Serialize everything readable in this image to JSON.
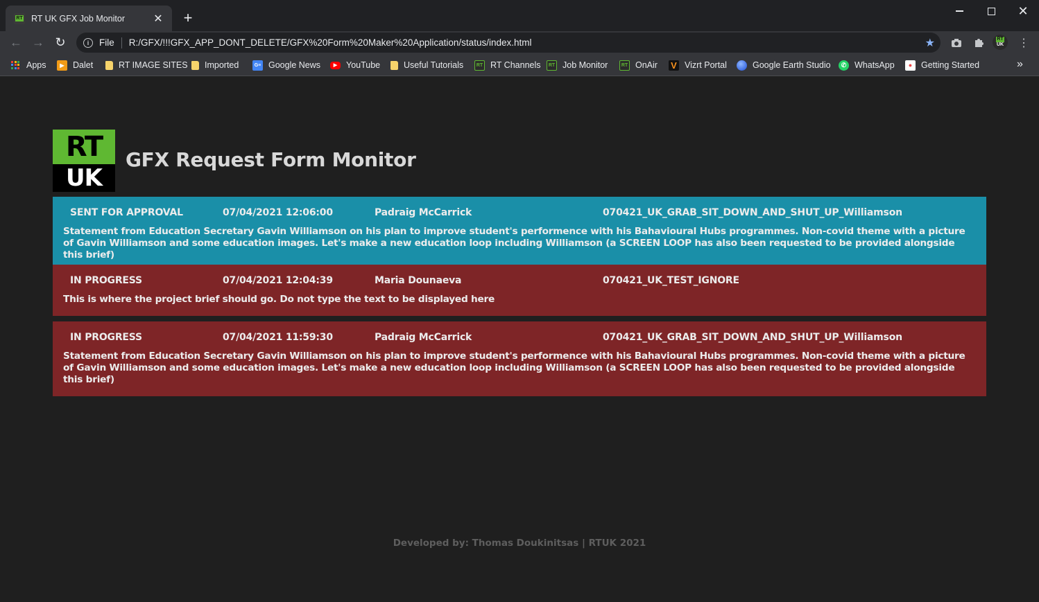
{
  "browser": {
    "tab_title": "RT UK GFX Job Monitor",
    "scheme_label": "File",
    "url": "R:/GFX/!!!GFX_APP_DONT_DELETE/GFX%20Form%20Maker%20Application/status/index.html",
    "profile_label_top": "RT",
    "profile_label_bottom": "UK"
  },
  "bookmarks": [
    {
      "label": "Apps",
      "icon": "apps-grid-icon"
    },
    {
      "label": "Dalet",
      "icon": "dalet-icon"
    },
    {
      "label": "RT IMAGE SITES",
      "icon": "folder-icon"
    },
    {
      "label": "Imported",
      "icon": "folder-icon"
    },
    {
      "label": "Google News",
      "icon": "google-news-icon"
    },
    {
      "label": "YouTube",
      "icon": "youtube-icon"
    },
    {
      "label": "Useful Tutorials",
      "icon": "folder-icon"
    },
    {
      "label": "RT Channels",
      "icon": "rt-icon"
    },
    {
      "label": "Job Monitor",
      "icon": "rt-icon"
    },
    {
      "label": "OnAir",
      "icon": "rt-icon"
    },
    {
      "label": "Vizrt Portal",
      "icon": "vizrt-icon"
    },
    {
      "label": "Google Earth Studio",
      "icon": "earth-icon"
    },
    {
      "label": "WhatsApp",
      "icon": "whatsapp-icon"
    },
    {
      "label": "Getting Started",
      "icon": "firefox-icon"
    }
  ],
  "page": {
    "logo_top": "RT",
    "logo_bottom": "UK",
    "title": "GFX Request Form Monitor",
    "footer": "Developed by: Thomas Doukinitsas | RTUK 2021"
  },
  "colors": {
    "approval": "#1a8fa8",
    "in_progress": "#7e2527",
    "brand_green": "#5fb832"
  },
  "jobs": [
    {
      "status": "SENT FOR APPROVAL",
      "datetime": "07/04/2021 12:06:00",
      "requester": "Padraig McCarrick",
      "code": "070421_UK_GRAB_SIT_DOWN_AND_SHUT_UP_Williamson",
      "brief": "Statement from Education Secretary Gavin Williamson on his plan to improve student's performence with his Bahavioural Hubs programmes. Non-covid theme with a picture of Gavin Williamson and some education images. Let's make a new education loop including Williamson (a SCREEN LOOP has also been requested to be provided alongside this brief)"
    },
    {
      "status": "IN PROGRESS",
      "datetime": "07/04/2021 12:04:39",
      "requester": "Maria Dounaeva",
      "code": "070421_UK_TEST_IGNORE",
      "brief": "This is where the project brief should go. Do not type the text to be displayed here"
    },
    {
      "status": "IN PROGRESS",
      "datetime": "07/04/2021 11:59:30",
      "requester": "Padraig McCarrick",
      "code": "070421_UK_GRAB_SIT_DOWN_AND_SHUT_UP_Williamson",
      "brief": "Statement from Education Secretary Gavin Williamson on his plan to improve student's performence with his Bahavioural Hubs programmes. Non-covid theme with a picture of Gavin Williamson and some education images. Let's make a new education loop including Williamson (a SCREEN LOOP has also been requested to be provided alongside this brief)"
    }
  ]
}
